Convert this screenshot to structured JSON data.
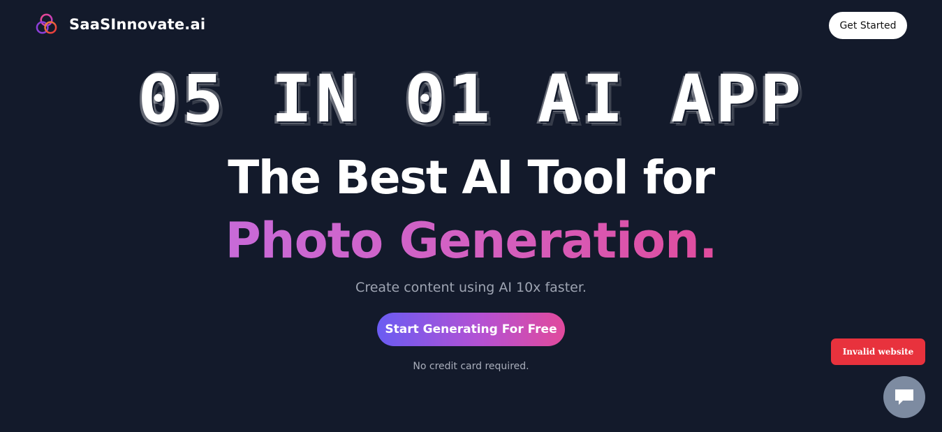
{
  "header": {
    "brand_name": "SaaSInnovate.ai",
    "get_started_label": "Get Started"
  },
  "hero": {
    "grunge_headline": "05 IN 01 AI APP",
    "title_line1": "The Best AI Tool for",
    "title_line2": "Photo Generation.",
    "subtitle": "Create content using AI 10x faster.",
    "cta_label": "Start Generating For Free",
    "note": "No credit card required."
  },
  "widgets": {
    "invalid_badge": "Invalid website",
    "chat_icon": "chat-icon"
  },
  "colors": {
    "background": "#131a2b",
    "gradient_start": "#6a5cf2",
    "gradient_end": "#e14a9c",
    "badge_red": "#e8323d",
    "chat_button": "#7d8ba1"
  }
}
